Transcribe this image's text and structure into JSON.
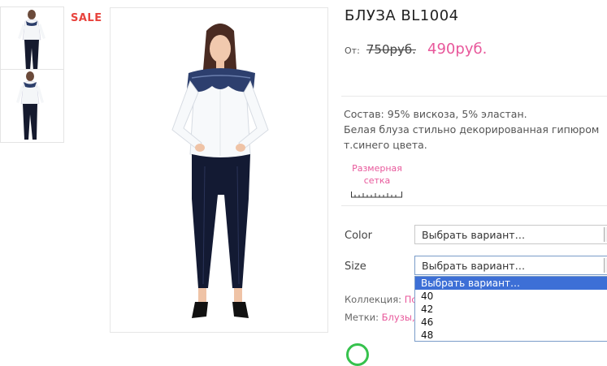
{
  "badge": {
    "sale": "SALE"
  },
  "product": {
    "title": "БЛУЗА BL1004",
    "price_prefix": "От:",
    "old_price": "750руб.",
    "new_price": "490руб.",
    "description_line1": "Состав: 95% вискоза, 5% эластан.",
    "description_line2": "Белая блуза стильно декорированная гипюром т.синего цвета."
  },
  "size_chart": {
    "line1": "Размерная",
    "line2": "сетка"
  },
  "variations": {
    "color_label": "Color",
    "color_value": "Выбрать вариант…",
    "size_label": "Size",
    "size_value": "Выбрать вариант…",
    "size_options": [
      "Выбрать вариант…",
      "40",
      "42",
      "46",
      "48"
    ]
  },
  "meta": {
    "collection_label": "Коллекция:",
    "collection_value": "По",
    "tags_label": "Метки:",
    "tags_value": "Блузы,"
  },
  "colors": {
    "accent": "#e8589b",
    "sale": "#e8433d",
    "highlight": "#3d6fd6"
  }
}
